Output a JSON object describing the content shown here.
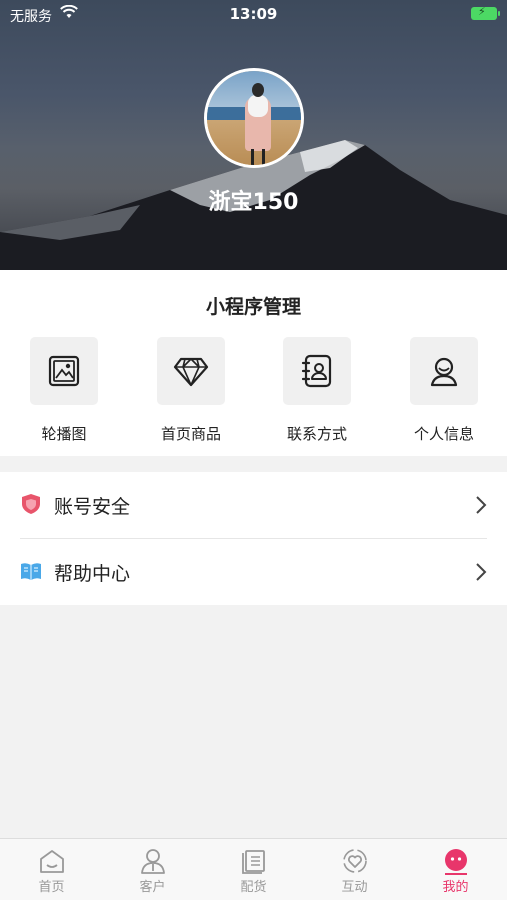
{
  "status_bar": {
    "carrier": "无服务",
    "time": "13:09"
  },
  "profile": {
    "username": "浙宝150"
  },
  "management": {
    "title": "小程序管理",
    "items": [
      {
        "label": "轮播图",
        "icon": "image-carousel-icon"
      },
      {
        "label": "首页商品",
        "icon": "diamond-icon"
      },
      {
        "label": "联系方式",
        "icon": "contacts-book-icon"
      },
      {
        "label": "个人信息",
        "icon": "person-icon"
      }
    ]
  },
  "menu": {
    "items": [
      {
        "label": "账号安全",
        "icon": "shield-icon",
        "icon_color": "#e8556b"
      },
      {
        "label": "帮助中心",
        "icon": "book-icon",
        "icon_color": "#4aa8e8"
      }
    ]
  },
  "tabbar": {
    "accent_color": "#e8366b",
    "items": [
      {
        "label": "首页",
        "icon": "home-icon"
      },
      {
        "label": "客户",
        "icon": "customer-icon"
      },
      {
        "label": "配货",
        "icon": "clipboard-icon"
      },
      {
        "label": "互动",
        "icon": "heart-interaction-icon"
      },
      {
        "label": "我的",
        "icon": "profile-face-icon",
        "active": true
      }
    ]
  }
}
